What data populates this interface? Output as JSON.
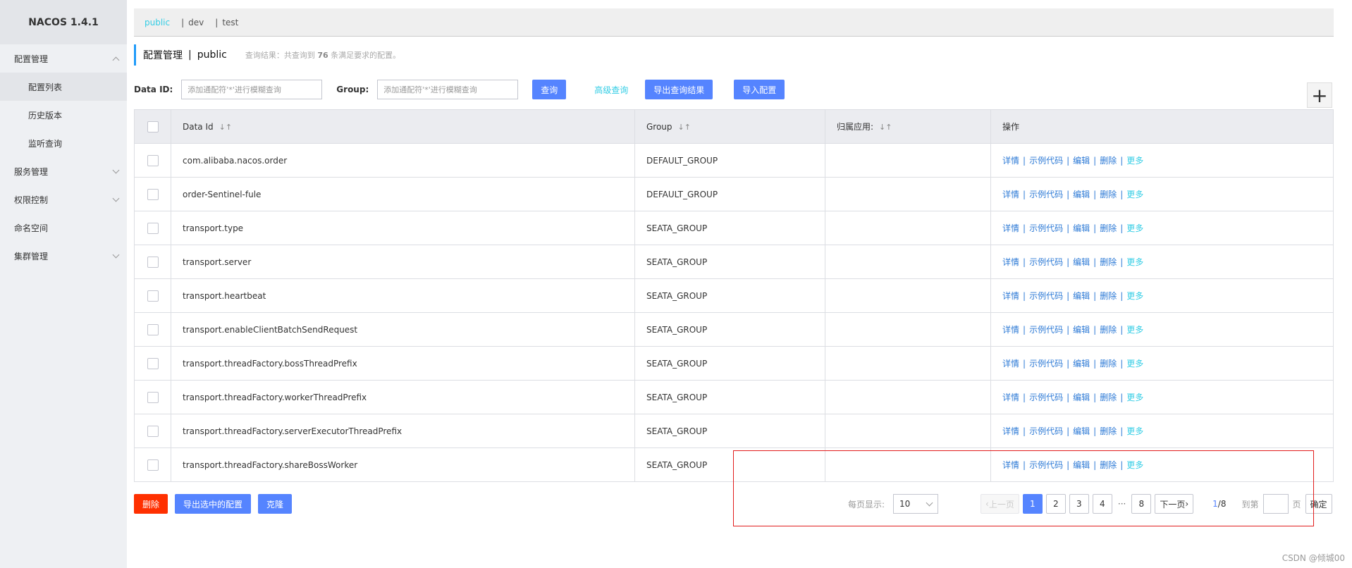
{
  "app": {
    "title": "NACOS 1.4.1"
  },
  "sidebar": {
    "items": [
      {
        "label": "配置管理",
        "expanded": true
      },
      {
        "label": "配置列表",
        "sub": true,
        "active": true
      },
      {
        "label": "历史版本",
        "sub": true
      },
      {
        "label": "监听查询",
        "sub": true
      },
      {
        "label": "服务管理",
        "expanded": false
      },
      {
        "label": "权限控制",
        "expanded": false
      },
      {
        "label": "命名空间"
      },
      {
        "label": "集群管理",
        "expanded": false
      }
    ]
  },
  "namespaces": {
    "active": "public",
    "others": [
      "dev",
      "test"
    ],
    "separator": "|"
  },
  "header": {
    "title": "配置管理",
    "separator": "|",
    "namespace": "public",
    "info_prefix": "查询结果：共查询到",
    "info_count": "76",
    "info_suffix": "条满足要求的配置。"
  },
  "search": {
    "dataid_label": "Data ID:",
    "dataid_placeholder": "添加通配符'*'进行模糊查询",
    "group_label": "Group:",
    "group_placeholder": "添加通配符'*'进行模糊查询",
    "query_button": "查询",
    "advanced_link": "高级查询",
    "export_button": "导出查询结果",
    "import_button": "导入配置",
    "add_icon": "plus-icon"
  },
  "table": {
    "columns": {
      "dataid": "Data Id",
      "group": "Group",
      "app": "归属应用:",
      "ops": "操作"
    },
    "ops": {
      "detail": "详情",
      "sample": "示例代码",
      "edit": "编辑",
      "delete": "删除",
      "more": "更多",
      "sep": "|"
    },
    "rows": [
      {
        "dataid": "com.alibaba.nacos.order",
        "group": "DEFAULT_GROUP",
        "app": ""
      },
      {
        "dataid": "order-Sentinel-fule",
        "group": "DEFAULT_GROUP",
        "app": ""
      },
      {
        "dataid": "transport.type",
        "group": "SEATA_GROUP",
        "app": ""
      },
      {
        "dataid": "transport.server",
        "group": "SEATA_GROUP",
        "app": ""
      },
      {
        "dataid": "transport.heartbeat",
        "group": "SEATA_GROUP",
        "app": ""
      },
      {
        "dataid": "transport.enableClientBatchSendRequest",
        "group": "SEATA_GROUP",
        "app": ""
      },
      {
        "dataid": "transport.threadFactory.bossThreadPrefix",
        "group": "SEATA_GROUP",
        "app": ""
      },
      {
        "dataid": "transport.threadFactory.workerThreadPrefix",
        "group": "SEATA_GROUP",
        "app": ""
      },
      {
        "dataid": "transport.threadFactory.serverExecutorThreadPrefix",
        "group": "SEATA_GROUP",
        "app": ""
      },
      {
        "dataid": "transport.threadFactory.shareBossWorker",
        "group": "SEATA_GROUP",
        "app": ""
      }
    ]
  },
  "bottom": {
    "delete_button": "删除",
    "export_selected_button": "导出选中的配置",
    "clone_button": "克隆"
  },
  "pagination": {
    "page_size_label": "每页显示:",
    "page_size": "10",
    "prev": "上一页",
    "pages": [
      "1",
      "2",
      "3",
      "4"
    ],
    "ellipsis": "···",
    "last_page": "8",
    "next": "下一页",
    "current_page": "1",
    "total_pages": "/8",
    "jump_label": "到第",
    "jump_unit": "页",
    "confirm": "确定"
  },
  "colors": {
    "accent": "#5584ff",
    "danger": "#ff3000",
    "link": "#33cde5",
    "annotation_box": "#e21c1c"
  },
  "watermark": "CSDN @倾城00"
}
